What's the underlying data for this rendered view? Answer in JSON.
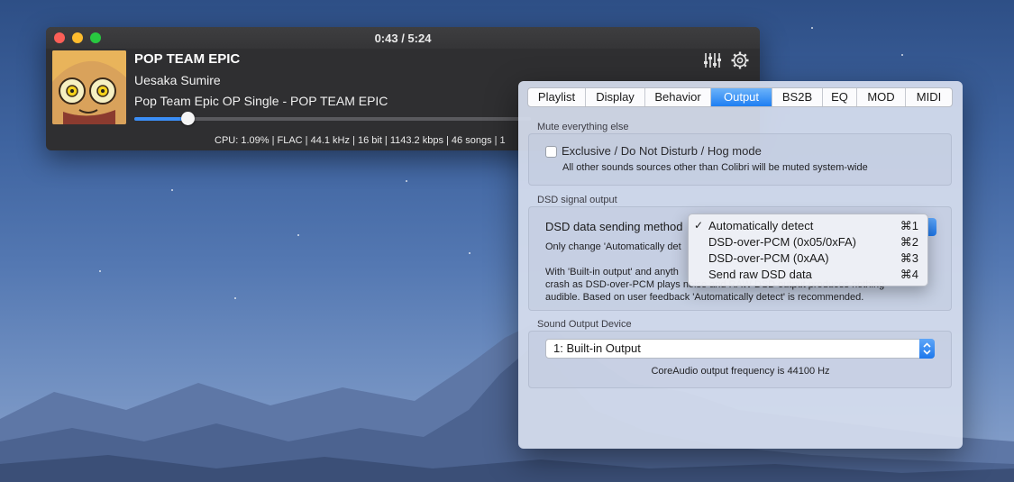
{
  "player": {
    "time": "0:43 / 5:24",
    "title": "POP TEAM EPIC",
    "artist": "Uesaka Sumire",
    "album": "Pop Team Epic OP Single - POP TEAM EPIC",
    "progress": 0.133,
    "status": "CPU: 1.09% | FLAC | 44.1 kHz | 16 bit | 1143.2 kbps | 46 songs | 1"
  },
  "prefs": {
    "tabs": [
      {
        "label": "Playlist"
      },
      {
        "label": "Display"
      },
      {
        "label": "Behavior"
      },
      {
        "label": "Output",
        "active": true
      },
      {
        "label": "BS2B"
      },
      {
        "label": "EQ"
      },
      {
        "label": "MOD"
      },
      {
        "label": "MIDI"
      }
    ],
    "mute_section": {
      "label": "Mute everything else",
      "checkbox_label": "Exclusive / Do Not Disturb / Hog mode",
      "checked": false,
      "description": "All other sounds sources other than Colibri will be muted system-wide"
    },
    "dsd_section": {
      "label": "DSD signal output",
      "method_label": "DSD data sending method",
      "note1": "Only change 'Automatically det",
      "note2": "With 'Built-in output' and anyth",
      "note3": "crash as DSD-over-PCM plays noise and RAW DSD output produces nothing",
      "note4": "audible. Based on user feedback 'Automatically detect' is recommended."
    },
    "device_section": {
      "label": "Sound Output Device",
      "selected": "1: Built-in Output",
      "frequency_text": "CoreAudio output frequency is 44100 Hz"
    }
  },
  "dsd_menu": {
    "items": [
      {
        "label": "Automatically detect",
        "shortcut": "⌘1",
        "checked": true
      },
      {
        "label": "DSD-over-PCM (0x05/0xFA)",
        "shortcut": "⌘2",
        "checked": false
      },
      {
        "label": "DSD-over-PCM (0xAA)",
        "shortcut": "⌘3",
        "checked": false
      },
      {
        "label": "Send raw DSD data",
        "shortcut": "⌘4",
        "checked": false
      }
    ],
    "check_glyph": "✓"
  },
  "colors": {
    "accent": "#1e7ef2",
    "player_bg": "#2f2f31",
    "progress": "#3b8ef6"
  },
  "icons": {
    "equalizer": "equalizer-sliders-icon",
    "settings": "gear-icon"
  }
}
